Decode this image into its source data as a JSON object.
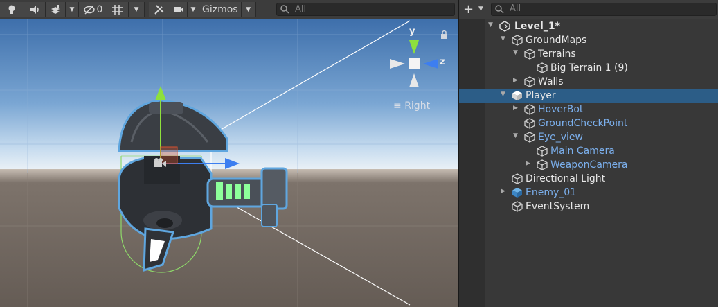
{
  "scene": {
    "toolbar": {
      "hidden_count": "0",
      "gizmos_label": "Gizmos",
      "search_placeholder": "All"
    },
    "orientation_label": "Right",
    "axis_labels": {
      "y": "y",
      "z": "z"
    },
    "colors": {
      "sky": "#4d7db6",
      "ground": "#6b625b",
      "selection_outline": "#5fa6df",
      "y_axis": "#8ee03c",
      "z_axis": "#3d7ef0"
    }
  },
  "hierarchy": {
    "search_placeholder": "All",
    "scene_name": "Level_1*",
    "rows": [
      {
        "label": "GroundMaps",
        "style": "white",
        "expand": "down"
      },
      {
        "label": "Terrains",
        "style": "white",
        "expand": "down"
      },
      {
        "label": "Big Terrain 1 (9)",
        "style": "white",
        "expand": "none"
      },
      {
        "label": "Walls",
        "style": "white",
        "expand": "right"
      },
      {
        "label": "Player",
        "style": "white",
        "expand": "down",
        "selected": true
      },
      {
        "label": "HoverBot",
        "style": "blue",
        "expand": "right"
      },
      {
        "label": "GroundCheckPoint",
        "style": "blue",
        "expand": "none"
      },
      {
        "label": "Eye_view",
        "style": "blue",
        "expand": "down"
      },
      {
        "label": "Main Camera",
        "style": "blue",
        "expand": "none"
      },
      {
        "label": "WeaponCamera",
        "style": "blue",
        "expand": "right"
      },
      {
        "label": "Directional Light",
        "style": "white",
        "expand": "none"
      },
      {
        "label": "Enemy_01",
        "style": "blue",
        "expand": "right"
      },
      {
        "label": "EventSystem",
        "style": "white",
        "expand": "none"
      }
    ],
    "colors": {
      "selected_row": "#2c5d87",
      "prefab_text": "#7bafec"
    }
  }
}
